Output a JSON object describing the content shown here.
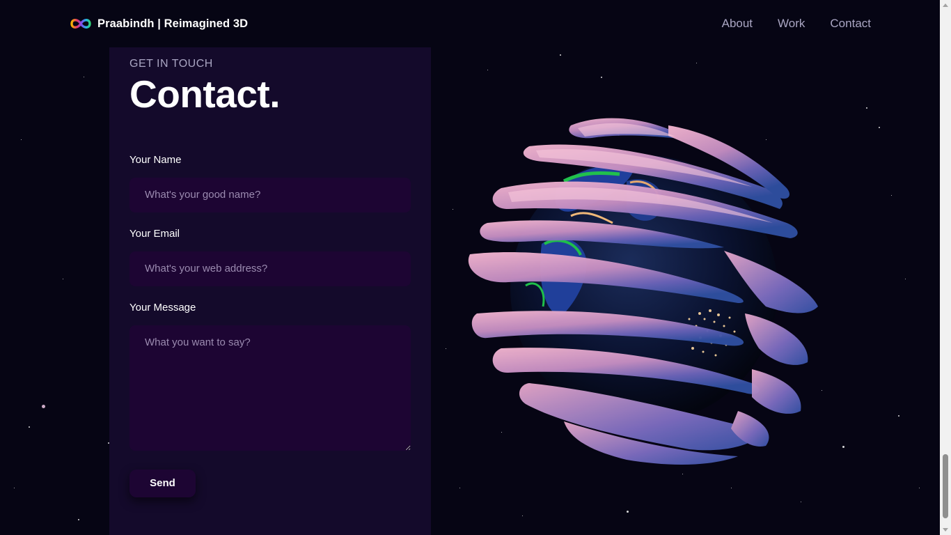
{
  "navbar": {
    "brand_name": "Praabindh | Reimagined 3D",
    "links": [
      "About",
      "Work",
      "Contact"
    ]
  },
  "contact": {
    "subtitle": "Get in touch",
    "title": "Contact.",
    "fields": [
      {
        "label": "Your Name",
        "placeholder": "What's your good name?"
      },
      {
        "label": "Your Email",
        "placeholder": "What's your web address?"
      },
      {
        "label": "Your Message",
        "placeholder": "What you want to say?"
      }
    ],
    "send_label": "Send"
  },
  "colors": {
    "background": "#060514",
    "card": "#140a2b",
    "input": "#1d0533",
    "secondary_text": "#aaa6c3"
  },
  "icons": {
    "brand_logo": "infinity-logo-icon"
  }
}
